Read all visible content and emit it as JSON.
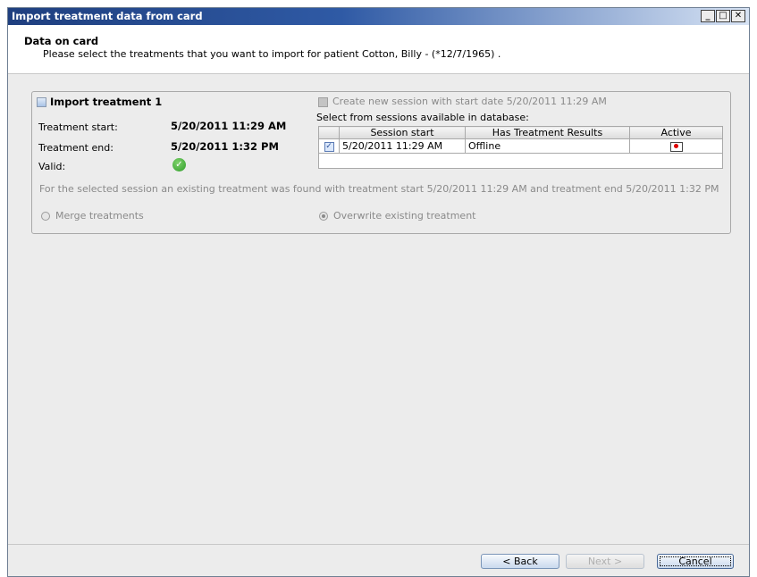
{
  "window": {
    "title": "Import treatment data from card",
    "controls": {
      "minimize": "_",
      "maximize": "□",
      "close": "✕"
    }
  },
  "header": {
    "title": "Data on card",
    "subtitle": "Please select the treatments that you want to import for patient Cotton, Billy - (*12/7/1965) ."
  },
  "treatment": {
    "label": "Import treatment 1",
    "start_label": "Treatment start:",
    "start_value": "5/20/2011 11:29 AM",
    "end_label": "Treatment end:",
    "end_value": "5/20/2011 1:32 PM",
    "valid_label": "Valid:",
    "valid_icon": "check-circle-icon",
    "create_session_label": "Create new session with start date 5/20/2011 11:29 AM",
    "select_label": "Select from sessions available in database:",
    "table": {
      "headers": [
        "",
        "Session start",
        "Has Treatment Results",
        "Active"
      ],
      "rows": [
        {
          "checked": true,
          "session_start": "5/20/2011 11:29 AM",
          "has_results": "Offline",
          "active_icon": "active-indicator-icon"
        }
      ]
    },
    "notice": "For the selected session an existing treatment was found with treatment start 5/20/2011 11:29 AM and treatment end 5/20/2011 1:32 PM",
    "merge_label": "Merge treatments",
    "overwrite_label": "Overwrite existing treatment"
  },
  "buttons": {
    "back": "< Back",
    "next": "Next >",
    "cancel": "Cancel"
  }
}
